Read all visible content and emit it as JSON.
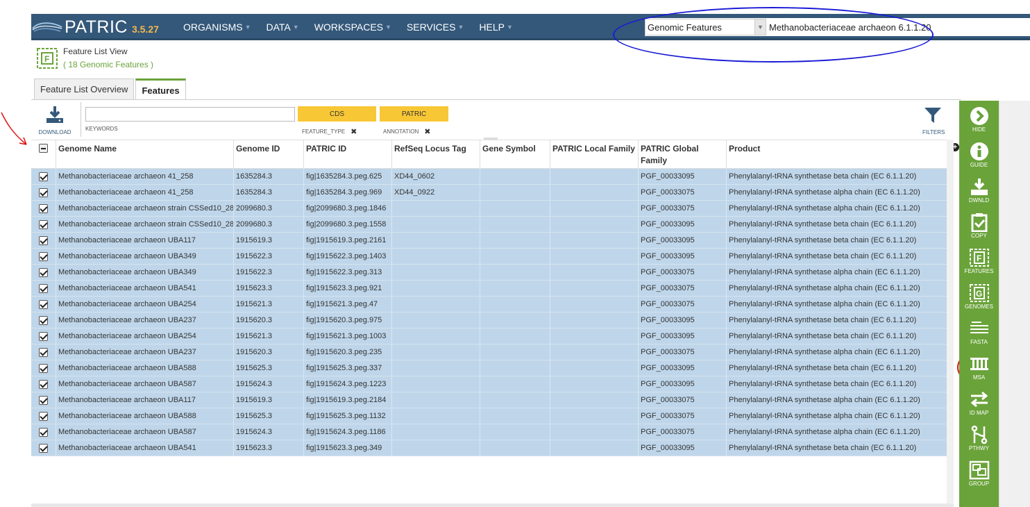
{
  "brand": {
    "name": "PATRIC",
    "version": "3.5.27"
  },
  "nav": [
    {
      "label": "ORGANISMS"
    },
    {
      "label": "DATA"
    },
    {
      "label": "WORKSPACES"
    },
    {
      "label": "SERVICES"
    },
    {
      "label": "HELP"
    }
  ],
  "search": {
    "scope": "Genomic Features",
    "value": "Methanobacteriaceae archaeon 6.1.1.20"
  },
  "header": {
    "title": "Feature List View",
    "subtitle": "( 18 Genomic Features )"
  },
  "tabs": [
    {
      "label": "Feature List Overview"
    },
    {
      "label": "Features"
    }
  ],
  "filterbar": {
    "download_label": "DOWNLOAD",
    "keywords_label": "KEYWORDS",
    "keywords_value": "",
    "tags": [
      {
        "value": "CDS",
        "field": "FEATURE_TYPE"
      },
      {
        "value": "PATRIC",
        "field": "ANNOTATION"
      }
    ],
    "filters_label": "FILTERS"
  },
  "grid": {
    "columns": [
      "Genome Name",
      "Genome ID",
      "PATRIC ID",
      "RefSeq Locus Tag",
      "Gene Symbol",
      "PATRIC Local Family",
      "PATRIC Global Family",
      "Product"
    ],
    "rows": [
      [
        "Methanobacteriaceae archaeon 41_258",
        "1635284.3",
        "fig|1635284.3.peg.625",
        "XD44_0602",
        "",
        "",
        "PGF_00033095",
        "Phenylalanyl-tRNA synthetase beta chain (EC 6.1.1.20)"
      ],
      [
        "Methanobacteriaceae archaeon 41_258",
        "1635284.3",
        "fig|1635284.3.peg.969",
        "XD44_0922",
        "",
        "",
        "PGF_00033075",
        "Phenylalanyl-tRNA synthetase alpha chain (EC 6.1.1.20)"
      ],
      [
        "Methanobacteriaceae archaeon strain CSSed10_28",
        "2099680.3",
        "fig|2099680.3.peg.1846",
        "",
        "",
        "",
        "PGF_00033075",
        "Phenylalanyl-tRNA synthetase alpha chain (EC 6.1.1.20)"
      ],
      [
        "Methanobacteriaceae archaeon strain CSSed10_28",
        "2099680.3",
        "fig|2099680.3.peg.1558",
        "",
        "",
        "",
        "PGF_00033095",
        "Phenylalanyl-tRNA synthetase beta chain (EC 6.1.1.20)"
      ],
      [
        "Methanobacteriaceae archaeon UBA117",
        "1915619.3",
        "fig|1915619.3.peg.2161",
        "",
        "",
        "",
        "PGF_00033095",
        "Phenylalanyl-tRNA synthetase beta chain (EC 6.1.1.20)"
      ],
      [
        "Methanobacteriaceae archaeon UBA349",
        "1915622.3",
        "fig|1915622.3.peg.1403",
        "",
        "",
        "",
        "PGF_00033095",
        "Phenylalanyl-tRNA synthetase beta chain (EC 6.1.1.20)"
      ],
      [
        "Methanobacteriaceae archaeon UBA349",
        "1915622.3",
        "fig|1915622.3.peg.313",
        "",
        "",
        "",
        "PGF_00033075",
        "Phenylalanyl-tRNA synthetase alpha chain (EC 6.1.1.20)"
      ],
      [
        "Methanobacteriaceae archaeon UBA541",
        "1915623.3",
        "fig|1915623.3.peg.921",
        "",
        "",
        "",
        "PGF_00033075",
        "Phenylalanyl-tRNA synthetase alpha chain (EC 6.1.1.20)"
      ],
      [
        "Methanobacteriaceae archaeon UBA254",
        "1915621.3",
        "fig|1915621.3.peg.47",
        "",
        "",
        "",
        "PGF_00033075",
        "Phenylalanyl-tRNA synthetase alpha chain (EC 6.1.1.20)"
      ],
      [
        "Methanobacteriaceae archaeon UBA237",
        "1915620.3",
        "fig|1915620.3.peg.975",
        "",
        "",
        "",
        "PGF_00033095",
        "Phenylalanyl-tRNA synthetase beta chain (EC 6.1.1.20)"
      ],
      [
        "Methanobacteriaceae archaeon UBA254",
        "1915621.3",
        "fig|1915621.3.peg.1003",
        "",
        "",
        "",
        "PGF_00033095",
        "Phenylalanyl-tRNA synthetase beta chain (EC 6.1.1.20)"
      ],
      [
        "Methanobacteriaceae archaeon UBA237",
        "1915620.3",
        "fig|1915620.3.peg.235",
        "",
        "",
        "",
        "PGF_00033075",
        "Phenylalanyl-tRNA synthetase alpha chain (EC 6.1.1.20)"
      ],
      [
        "Methanobacteriaceae archaeon UBA588",
        "1915625.3",
        "fig|1915625.3.peg.337",
        "",
        "",
        "",
        "PGF_00033095",
        "Phenylalanyl-tRNA synthetase beta chain (EC 6.1.1.20)"
      ],
      [
        "Methanobacteriaceae archaeon UBA587",
        "1915624.3",
        "fig|1915624.3.peg.1223",
        "",
        "",
        "",
        "PGF_00033095",
        "Phenylalanyl-tRNA synthetase beta chain (EC 6.1.1.20)"
      ],
      [
        "Methanobacteriaceae archaeon UBA117",
        "1915619.3",
        "fig|1915619.3.peg.2184",
        "",
        "",
        "",
        "PGF_00033075",
        "Phenylalanyl-tRNA synthetase alpha chain (EC 6.1.1.20)"
      ],
      [
        "Methanobacteriaceae archaeon UBA588",
        "1915625.3",
        "fig|1915625.3.peg.1132",
        "",
        "",
        "",
        "PGF_00033075",
        "Phenylalanyl-tRNA synthetase alpha chain (EC 6.1.1.20)"
      ],
      [
        "Methanobacteriaceae archaeon UBA587",
        "1915624.3",
        "fig|1915624.3.peg.1186",
        "",
        "",
        "",
        "PGF_00033075",
        "Phenylalanyl-tRNA synthetase alpha chain (EC 6.1.1.20)"
      ],
      [
        "Methanobacteriaceae archaeon UBA541",
        "1915623.3",
        "fig|1915623.3.peg.349",
        "",
        "",
        "",
        "PGF_00033095",
        "Phenylalanyl-tRNA synthetase beta chain (EC 6.1.1.20)"
      ]
    ]
  },
  "actions": [
    {
      "label": "HIDE",
      "icon": "chevron-right-circle-icon"
    },
    {
      "label": "GUIDE",
      "icon": "info-circle-icon"
    },
    {
      "label": "DWNLD",
      "icon": "download-icon"
    },
    {
      "label": "COPY",
      "icon": "clipboard-check-icon"
    },
    {
      "label": "FEATURES",
      "icon": "feature-list-icon"
    },
    {
      "label": "GENOMES",
      "icon": "genome-list-icon"
    },
    {
      "label": "FASTA",
      "icon": "fasta-icon"
    },
    {
      "label": "MSA",
      "icon": "msa-icon"
    },
    {
      "label": "ID MAP",
      "icon": "id-map-icon"
    },
    {
      "label": "PTHWY",
      "icon": "pathway-icon"
    },
    {
      "label": "GROUP",
      "icon": "group-icon"
    }
  ],
  "colors": {
    "nav_bg": "#34587a",
    "accent_green": "#6aa33a",
    "tag_yellow": "#f8c736",
    "row_selected": "#bfd6ea",
    "version_orange": "#f6b94c"
  }
}
